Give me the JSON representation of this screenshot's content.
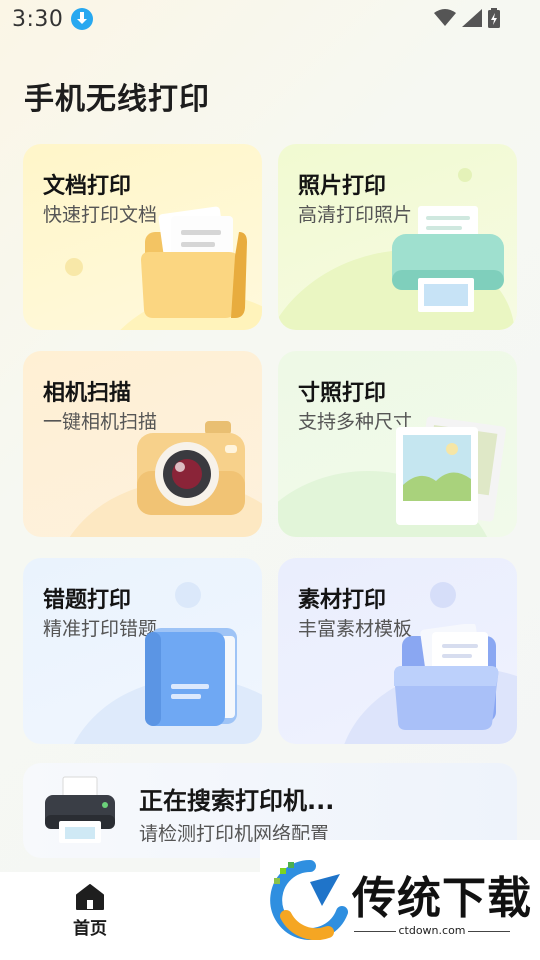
{
  "status_bar": {
    "time": "3:30",
    "icons": [
      "download-icon",
      "wifi-icon",
      "signal-icon",
      "battery-charging-icon"
    ]
  },
  "header": {
    "title": "手机无线打印"
  },
  "features": [
    {
      "title": "文档打印",
      "subtitle": "快速打印文档",
      "icon": "document-folder-icon"
    },
    {
      "title": "照片打印",
      "subtitle": "高清打印照片",
      "icon": "photo-printer-icon"
    },
    {
      "title": "相机扫描",
      "subtitle": "一键相机扫描",
      "icon": "camera-icon"
    },
    {
      "title": "寸照打印",
      "subtitle": "支持多种尺寸",
      "icon": "photo-prints-icon"
    },
    {
      "title": "错题打印",
      "subtitle": "精准打印错题",
      "icon": "book-icon"
    },
    {
      "title": "素材打印",
      "subtitle": "丰富素材模板",
      "icon": "material-folder-icon"
    }
  ],
  "printer_search": {
    "title": "正在搜索打印机...",
    "subtitle": "请检测打印机网络配置",
    "icon": "printer-icon"
  },
  "bottom_nav": {
    "items": [
      {
        "label": "首页",
        "icon": "home-icon",
        "active": true
      }
    ]
  },
  "watermark": {
    "text": "传统下载",
    "url": "ctdown.com"
  },
  "colors": {
    "accent_blue": "#27a8f0",
    "doc_card": "#fff6c9",
    "photo_card": "#f1fad1",
    "camera_card": "#fff0d4",
    "id_card": "#eef9e6",
    "wrong_card": "#eaf3fd",
    "material_card": "#eaeefd"
  }
}
